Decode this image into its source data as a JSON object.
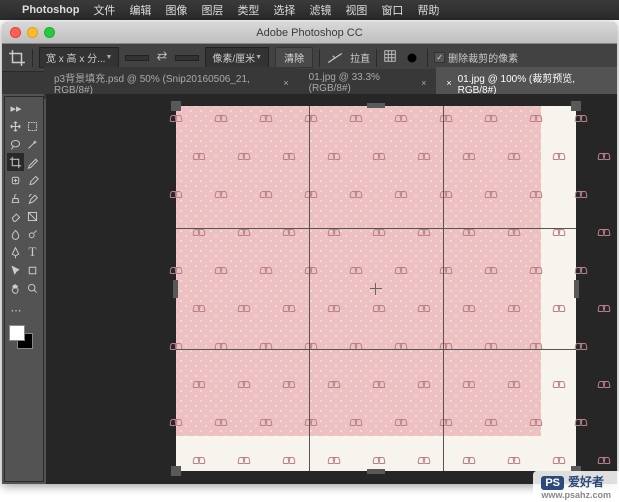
{
  "menubar": {
    "app": "Photoshop",
    "items": [
      "文件",
      "编辑",
      "图像",
      "图层",
      "类型",
      "选择",
      "滤镜",
      "视图",
      "窗口",
      "帮助"
    ]
  },
  "window": {
    "title": "Adobe Photoshop CC"
  },
  "options_bar": {
    "ratio_label": "宽 x 高 x 分...",
    "unit": "像素/厘米",
    "clear": "清除",
    "straighten": "拉直",
    "delete_cropped": "删除裁剪的像素"
  },
  "tabs": [
    {
      "label": "p3背景填充.psd @ 50% (Snip20160506_21, RGB/8#)"
    },
    {
      "label": "01.jpg @ 33.3%(RGB/8#)"
    },
    {
      "label": "01.jpg @ 100% (裁剪预览, RGB/8#)"
    }
  ],
  "watermark": {
    "badge": "PS",
    "text": "爱好者",
    "url": "www.psahz.com"
  }
}
